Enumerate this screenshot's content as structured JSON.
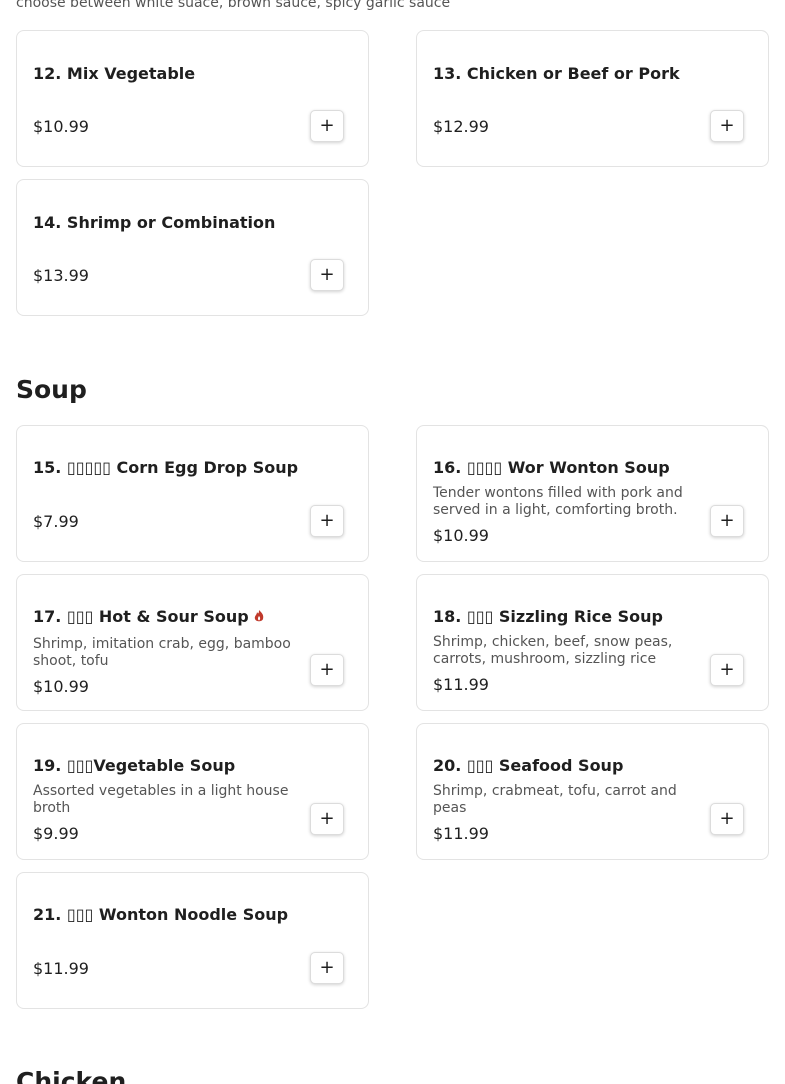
{
  "sauce_note": "choose between white suace, brown sauce, spicy garlic sauce",
  "items": {
    "i12": {
      "title": "12. Mix Vegetable",
      "price": "$10.99",
      "add": "+"
    },
    "i13": {
      "title": "13. Chicken or Beef or Pork",
      "price": "$12.99",
      "add": "+"
    },
    "i14": {
      "title": "14. Shrimp or Combination",
      "price": "$13.99",
      "add": "+"
    },
    "i15": {
      "title": "15. ▯▯▯▯▯ Corn Egg Drop Soup",
      "price": "$7.99",
      "add": "+"
    },
    "i16": {
      "title": "16. ▯▯▯▯ Wor Wonton Soup",
      "desc": "Tender wontons filled with pork and served in a light, comforting broth.",
      "price": "$10.99",
      "add": "+"
    },
    "i17": {
      "title": "17. ▯▯▯ Hot & Sour Soup",
      "desc": "Shrimp, imitation crab, egg, bamboo shoot, tofu",
      "price": "$10.99",
      "add": "+",
      "icon": "spicy-chili-icon"
    },
    "i18": {
      "title": "18. ▯▯▯ Sizzling Rice Soup",
      "desc": "Shrimp, chicken, beef, snow peas, carrots, mushroom, sizzling rice",
      "price": "$11.99",
      "add": "+"
    },
    "i19": {
      "title": "19. ▯▯▯Vegetable Soup",
      "desc": "Assorted vegetables in a light house broth",
      "price": "$9.99",
      "add": "+"
    },
    "i20": {
      "title": "20. ▯▯▯ Seafood Soup",
      "desc": "Shrimp, crabmeat, tofu, carrot and peas",
      "price": "$11.99",
      "add": "+"
    },
    "i21": {
      "title": "21. ▯▯▯ Wonton Noodle Soup",
      "price": "$11.99",
      "add": "+"
    }
  },
  "sections": {
    "soup": "Soup",
    "chicken": "Chicken"
  },
  "colors": {
    "spicy": "#c0392b",
    "border": "#e3e3e3",
    "muted_text": "#555555"
  }
}
